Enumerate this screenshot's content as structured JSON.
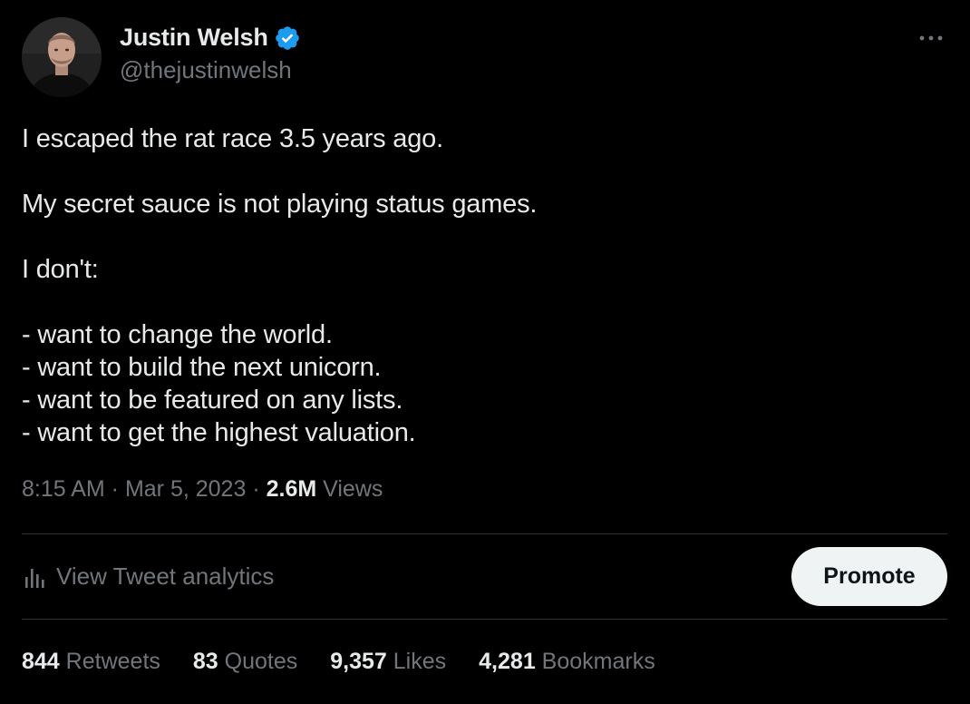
{
  "author": {
    "display_name": "Justin Welsh",
    "handle": "@thejustinwelsh",
    "verified": true
  },
  "icons": {
    "verified": "verified-badge-icon",
    "more": "more-horizontal-icon",
    "analytics": "analytics-bars-icon"
  },
  "colors": {
    "background": "#000000",
    "text": "#e7e9ea",
    "secondary": "#71767b",
    "verified": "#1d9bf0",
    "divider": "#2f3336",
    "promote_bg": "#eff3f4"
  },
  "tweet": {
    "lines": [
      "I escaped the rat race 3.5 years ago.",
      "",
      "My secret sauce is not playing status games.",
      "",
      "I don't:",
      "",
      "- want to change the world.",
      "- want to build the next unicorn.",
      "- want to be featured on any lists.",
      "- want to get the highest valuation."
    ]
  },
  "meta": {
    "time": "8:15 AM",
    "sep1": " · ",
    "date": "Mar 5, 2023",
    "sep2": " · ",
    "views_count": "2.6M",
    "views_label": " Views"
  },
  "actions": {
    "analytics_label": "View Tweet analytics",
    "promote_label": "Promote"
  },
  "stats": [
    {
      "count": "844",
      "label": "Retweets"
    },
    {
      "count": "83",
      "label": "Quotes"
    },
    {
      "count": "9,357",
      "label": "Likes"
    },
    {
      "count": "4,281",
      "label": "Bookmarks"
    }
  ]
}
